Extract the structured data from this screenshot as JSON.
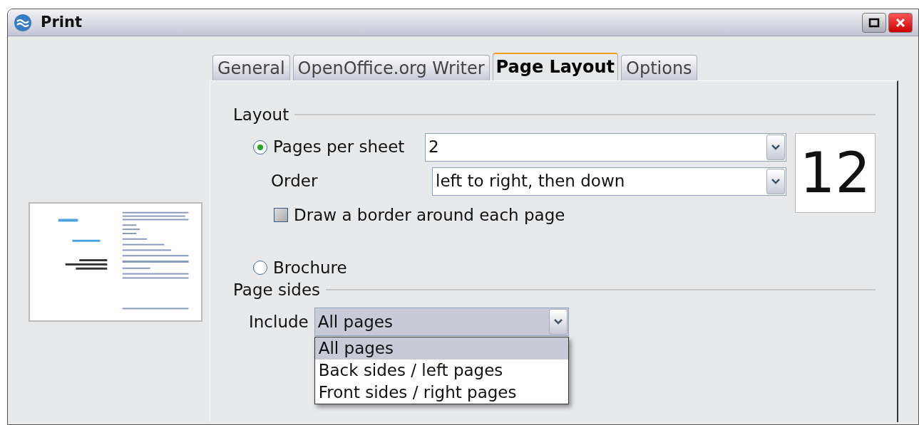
{
  "window": {
    "title": "Print"
  },
  "tabs": [
    {
      "label": "General",
      "selected": false
    },
    {
      "label": "OpenOffice.org Writer",
      "selected": false
    },
    {
      "label": "Page Layout",
      "selected": true
    },
    {
      "label": "Options",
      "selected": false
    }
  ],
  "layout": {
    "title": "Layout",
    "pages_per_sheet": {
      "label": "Pages per sheet",
      "selected": true,
      "value": "2"
    },
    "order": {
      "label": "Order",
      "value": "left to right, then down"
    },
    "draw_border": {
      "label": "Draw a border around each page",
      "checked": false
    },
    "preview_number": "12",
    "brochure": {
      "label": "Brochure",
      "selected": false
    }
  },
  "page_sides": {
    "title": "Page sides",
    "include": {
      "label": "Include",
      "value": "All pages",
      "expanded": true,
      "options": [
        {
          "label": "All pages",
          "selected": true
        },
        {
          "label": "Back sides / left pages",
          "selected": false
        },
        {
          "label": "Front sides / right pages",
          "selected": false
        }
      ]
    }
  }
}
